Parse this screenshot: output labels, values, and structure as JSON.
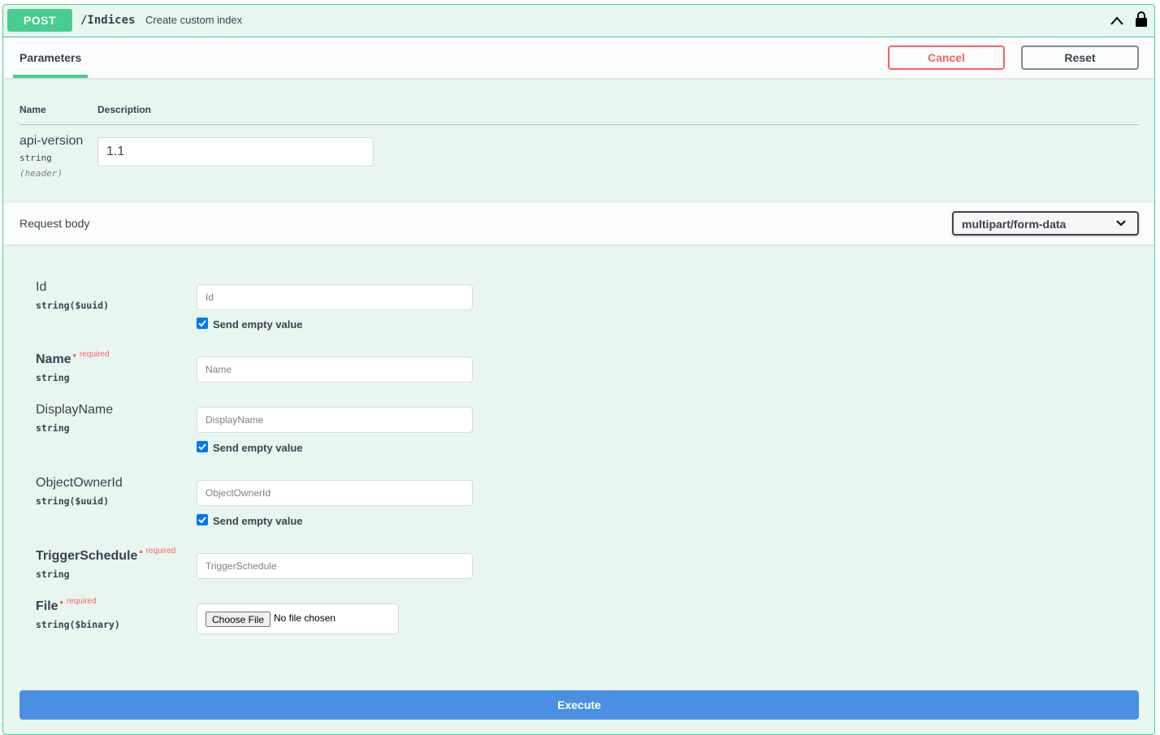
{
  "summary": {
    "method": "POST",
    "path": "/Indices",
    "description": "Create custom index"
  },
  "section": {
    "tab_label": "Parameters",
    "cancel_label": "Cancel",
    "reset_label": "Reset"
  },
  "params_table": {
    "col_name": "Name",
    "col_description": "Description",
    "rows": [
      {
        "name": "api-version",
        "type": "string",
        "in": "(header)",
        "value": "1.1"
      }
    ]
  },
  "request_body": {
    "title": "Request body",
    "content_type": "multipart/form-data",
    "fields": [
      {
        "name": "Id",
        "type": "string($uuid)",
        "placeholder": "Id",
        "send_empty_label": "Send empty value",
        "send_empty_checked": true
      },
      {
        "name": "Name",
        "type": "string",
        "placeholder": "Name",
        "required_mark": "*",
        "required_label": "required"
      },
      {
        "name": "DisplayName",
        "type": "string",
        "placeholder": "DisplayName",
        "send_empty_label": "Send empty value",
        "send_empty_checked": true
      },
      {
        "name": "ObjectOwnerId",
        "type": "string($uuid)",
        "placeholder": "ObjectOwnerId",
        "send_empty_label": "Send empty value",
        "send_empty_checked": true
      },
      {
        "name": "TriggerSchedule",
        "type": "string",
        "placeholder": "TriggerSchedule",
        "required_mark": "*",
        "required_label": "required"
      },
      {
        "name": "File",
        "type": "string($binary)",
        "required_mark": "*",
        "required_label": "required",
        "file_button": "Choose File",
        "file_status": "No file chosen"
      }
    ]
  },
  "execute_label": "Execute",
  "colors": {
    "post_green": "#49cc90",
    "block_bg": "#e8f6f0",
    "cancel_red": "#ff6060",
    "execute_blue": "#4990e2"
  },
  "icons": [
    "chevron-up-icon",
    "lock-icon",
    "chevron-down-icon",
    "checkbox-check-icon"
  ]
}
